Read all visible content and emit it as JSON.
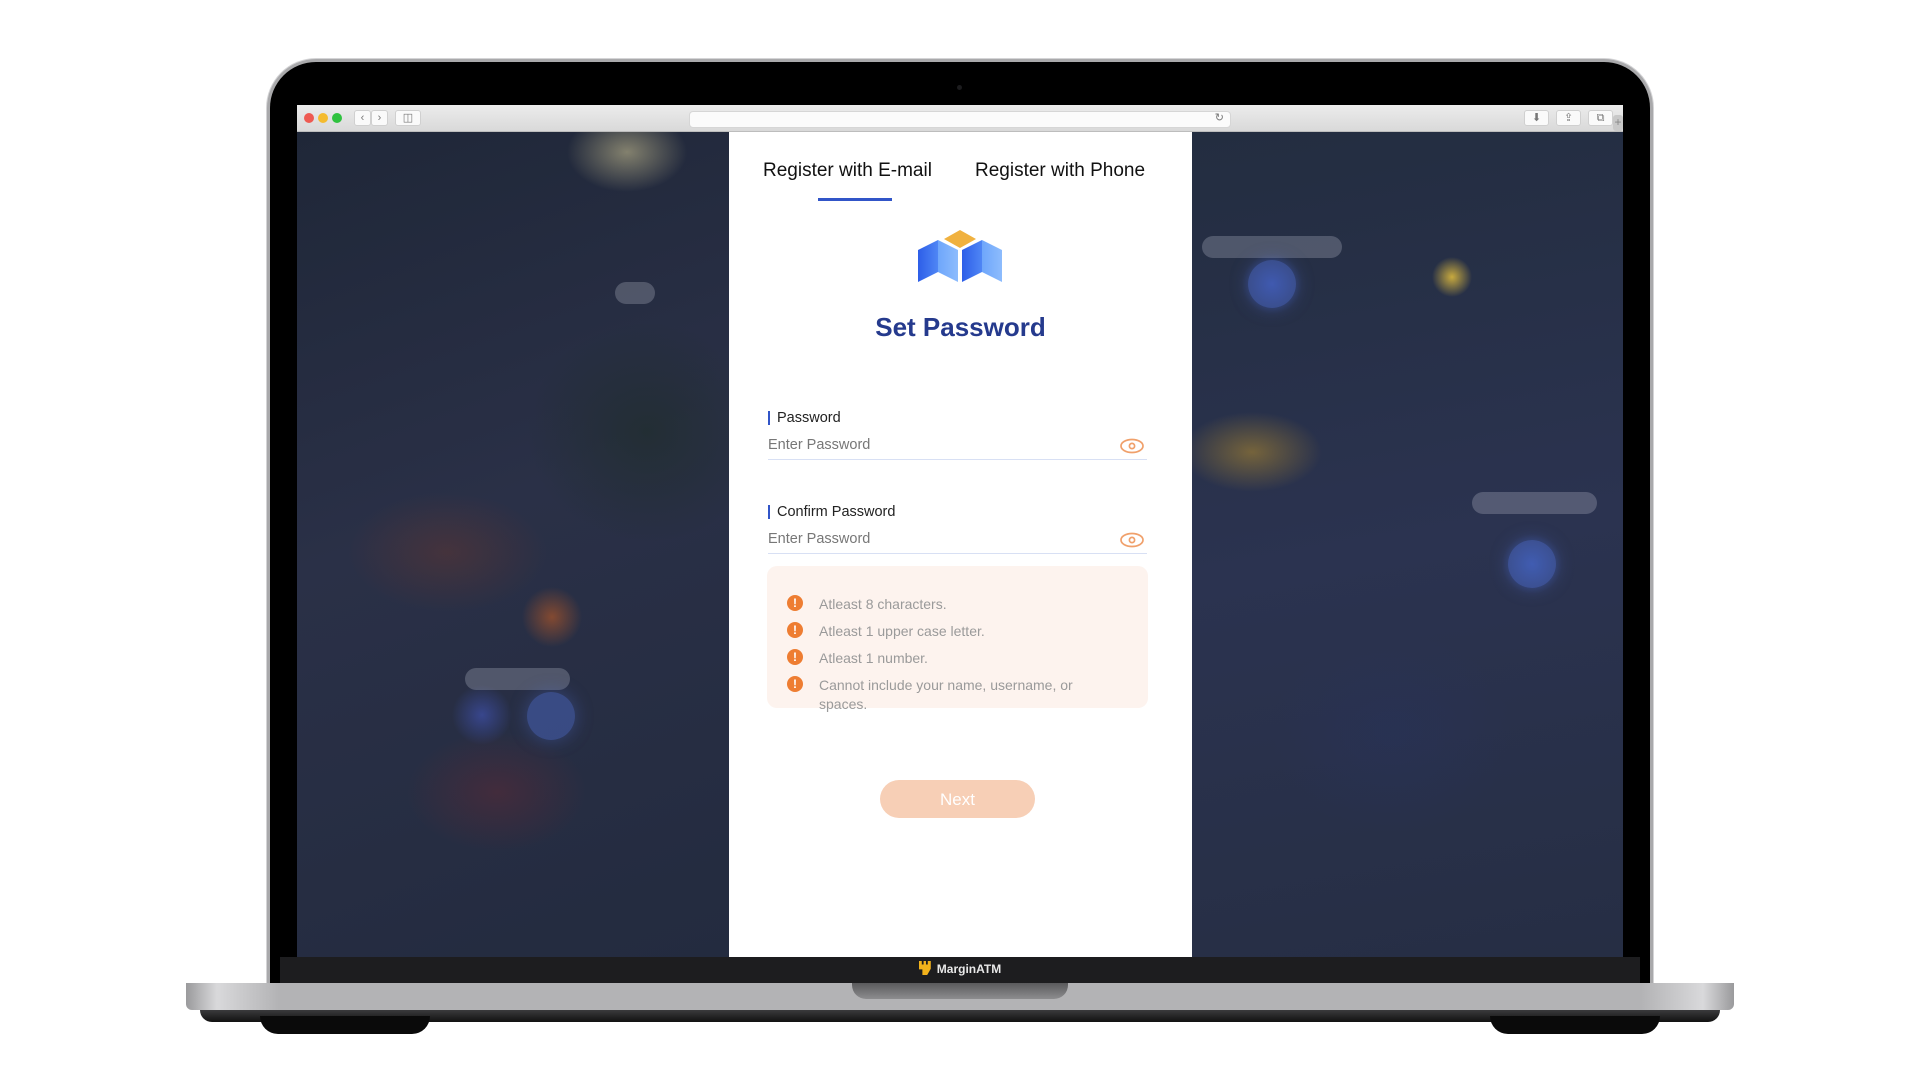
{
  "browser": {
    "traffic_lights": {
      "close": "#ee5a52",
      "minimize": "#f4bb2f",
      "maximize": "#2fc23f"
    },
    "back_icon": "chevron-left-icon",
    "forward_icon": "chevron-right-icon",
    "sidebar_icon": "sidebar-icon",
    "url_value": "",
    "reload_icon": "reload-icon",
    "right_buttons": [
      "download-icon",
      "share-icon",
      "tabs-icon"
    ],
    "new_tab_icon": "plus-icon"
  },
  "form": {
    "tabs": [
      {
        "label": "Register with E-mail",
        "active": true
      },
      {
        "label": "Register with Phone",
        "active": false
      }
    ],
    "title": "Set Password",
    "fields": [
      {
        "label": "Password",
        "value": "",
        "placeholder": "Enter Password"
      },
      {
        "label": "Confirm Password",
        "value": "",
        "placeholder": "Enter Password"
      }
    ],
    "rules": [
      "Atleast 8 characters.",
      "Atleast 1 upper case letter.",
      "Atleast 1 number.",
      "Cannot include your name, username, or spaces."
    ],
    "rule_icon_glyph": "!",
    "next_label": "Next",
    "colors": {
      "accent": "#3155c8",
      "title": "#253a8d",
      "warning": "#ee7d32",
      "rules_bg": "#fdf3ee",
      "next_disabled": "#f7cfb6"
    }
  },
  "device": {
    "brand_label": "MarginATM"
  }
}
